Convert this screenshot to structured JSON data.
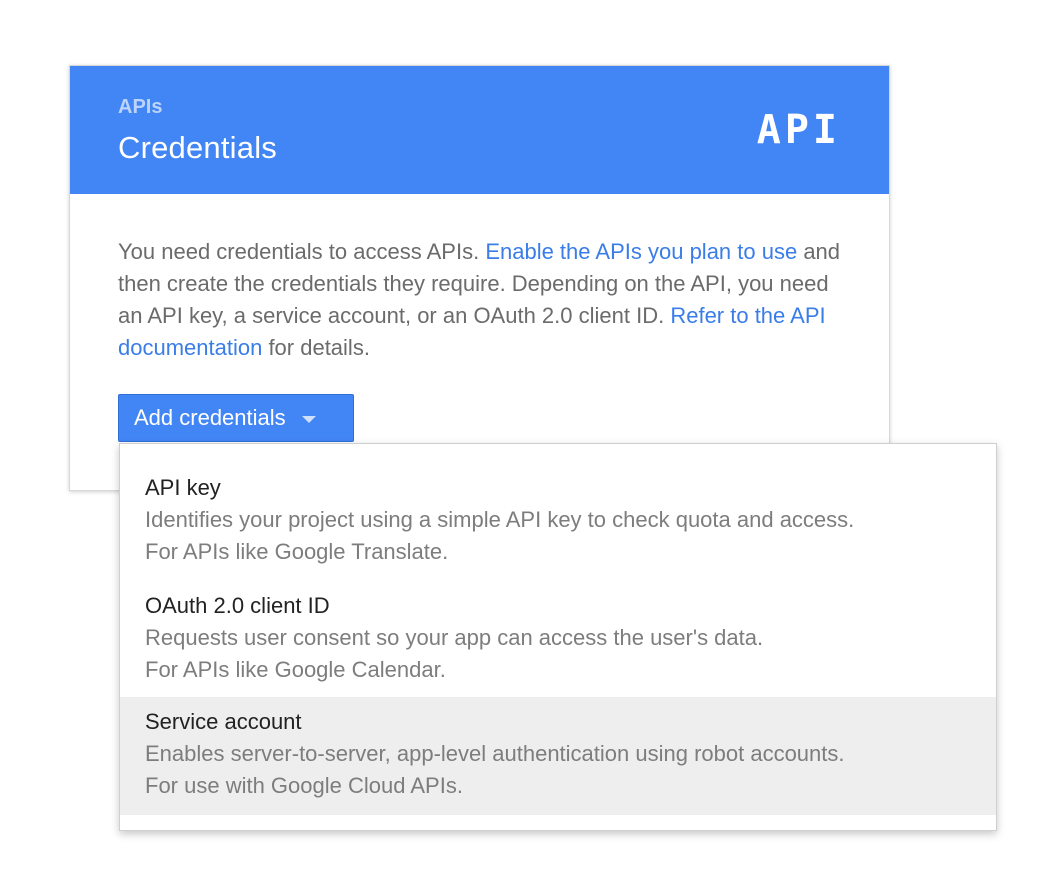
{
  "header": {
    "kicker": "APIs",
    "title": "Credentials",
    "logo_text": "API",
    "background_color": "#4285f4"
  },
  "intro": {
    "text_1": "You need credentials to access APIs. ",
    "link_1": "Enable the APIs you plan to use",
    "text_2": " and then create the credentials they require. Depending on the API, you need an API key, a service account, or an OAuth 2.0 client ID. ",
    "link_2": "Refer to the API documentation",
    "text_3": " for details."
  },
  "add_button": {
    "label": "Add credentials",
    "icon": "caret-down-icon"
  },
  "menu": {
    "items": [
      {
        "title": "API key",
        "line1": "Identifies your project using a simple API key to check quota and access.",
        "line2": "For APIs like Google Translate."
      },
      {
        "title": "OAuth 2.0 client ID",
        "line1": "Requests user consent so your app can access the user's data.",
        "line2": "For APIs like Google Calendar."
      },
      {
        "title": "Service account",
        "line1": "Enables server-to-server, app-level authentication using robot accounts.",
        "line2": "For use with Google Cloud APIs.",
        "highlighted": true
      }
    ]
  }
}
